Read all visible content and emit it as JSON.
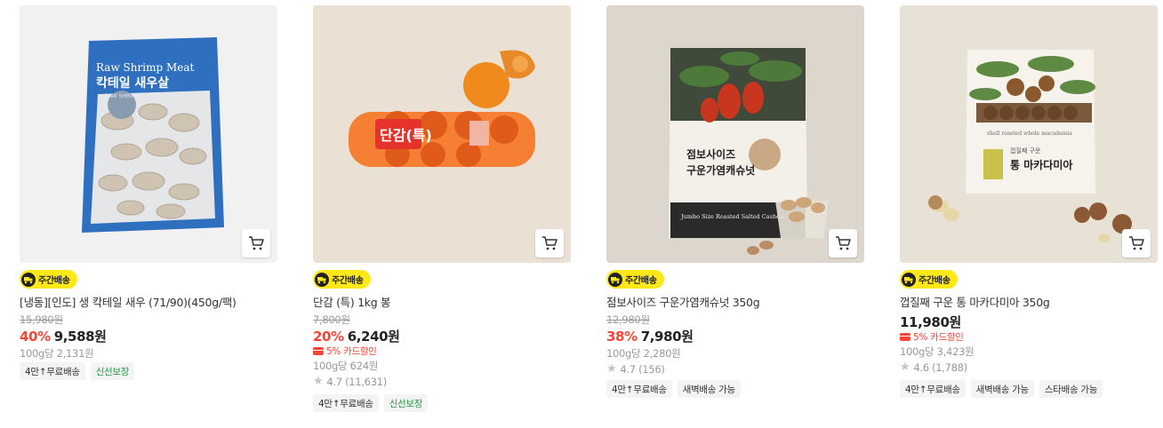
{
  "products": [
    {
      "badge": "주간배송",
      "name": "[냉동][인도] 생 칵테일 새우 (71/90)(450g/팩)",
      "original_price": "15,980원",
      "discount": "40%",
      "price": "9,588원",
      "unit_price": "100g당 2,131원",
      "tags": [
        "4만↑무료배송",
        "신선보장"
      ],
      "package_text_en": "Raw Shrimp Meat",
      "package_text_ko": "칵테일 새우살",
      "package_sub": "RAW SHRIMP 100%"
    },
    {
      "badge": "주간배송",
      "name": "단감 (특) 1kg 봉",
      "original_price": "7,800원",
      "discount": "20%",
      "price": "6,240원",
      "card_discount": "5% 카드할인",
      "unit_price": "100g당 624원",
      "rating": "4.7 (11,631)",
      "tags": [
        "4만↑무료배송",
        "신선보장"
      ],
      "package_text_ko": "단감(특)"
    },
    {
      "badge": "주간배송",
      "name": "점보사이즈 구운가염캐슈넛 350g",
      "original_price": "12,980원",
      "discount": "38%",
      "price": "7,980원",
      "unit_price": "100g당 2,280원",
      "rating": "4.7 (156)",
      "tags": [
        "4만↑무료배송",
        "새벽배송 가능"
      ],
      "package_text_ko_1": "점보사이즈",
      "package_text_ko_2": "구운가염캐슈넛",
      "package_text_en": "Jumbo Size Roasted Salted Cashew"
    },
    {
      "badge": "주간배송",
      "name": "껍질째 구운 통 마카다미아 350g",
      "price": "11,980원",
      "card_discount": "5% 카드할인",
      "unit_price": "100g당 3,423원",
      "rating": "4.6 (1,788)",
      "tags": [
        "4만↑무료배송",
        "새벽배송 가능",
        "스타배송 가능"
      ],
      "package_text_ko_1": "껍질째 구운",
      "package_text_ko_2": "통 마카다미아",
      "package_text_en": "shell roasted whole macadamia"
    }
  ],
  "icons": {
    "cart": "cart-icon",
    "truck": "truck-icon",
    "star": "star-icon",
    "card": "card-icon"
  },
  "colors": {
    "accent_red": "#fa4435",
    "badge_yellow": "#ffe81a",
    "tag_green": "#1f9a3c"
  }
}
